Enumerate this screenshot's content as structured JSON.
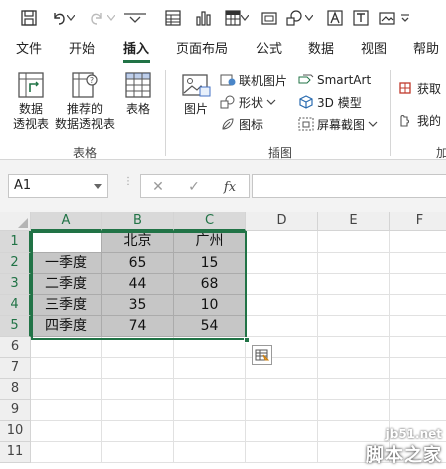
{
  "tabs": [
    {
      "label": "文件"
    },
    {
      "label": "开始"
    },
    {
      "label": "插入",
      "active": true
    },
    {
      "label": "页面布局"
    },
    {
      "label": "公式"
    },
    {
      "label": "数据"
    },
    {
      "label": "视图"
    },
    {
      "label": "帮助"
    }
  ],
  "ribbon": {
    "pivot_table": "数据\n透视表",
    "recommended_pivot": "推荐的\n数据透视表",
    "table": "表格",
    "tables_group": "表格",
    "pictures": "图片",
    "online_pictures": "联机图片",
    "shapes": "形状",
    "icons": "图标",
    "smartart": "SmartArt",
    "model3d": "3D 模型",
    "screenshot": "屏幕截图",
    "illustrations_group": "插图",
    "get_addins": "获取",
    "my_addins": "我的",
    "addins_group": "加"
  },
  "formula_bar": {
    "name_box": "A1",
    "fx": "fx",
    "formula": ""
  },
  "grid": {
    "columns": [
      "A",
      "B",
      "C",
      "D",
      "E",
      "F"
    ],
    "rows": [
      "1",
      "2",
      "3",
      "4",
      "5",
      "6",
      "7",
      "8",
      "9",
      "10",
      "11"
    ],
    "cells": [
      [
        "",
        "北京",
        "广州"
      ],
      [
        "一季度",
        "65",
        "15"
      ],
      [
        "二季度",
        "44",
        "68"
      ],
      [
        "三季度",
        "35",
        "10"
      ],
      [
        "四季度",
        "74",
        "54"
      ]
    ]
  },
  "watermark": {
    "top": "jb51.net",
    "bottom": "脚本之家"
  }
}
